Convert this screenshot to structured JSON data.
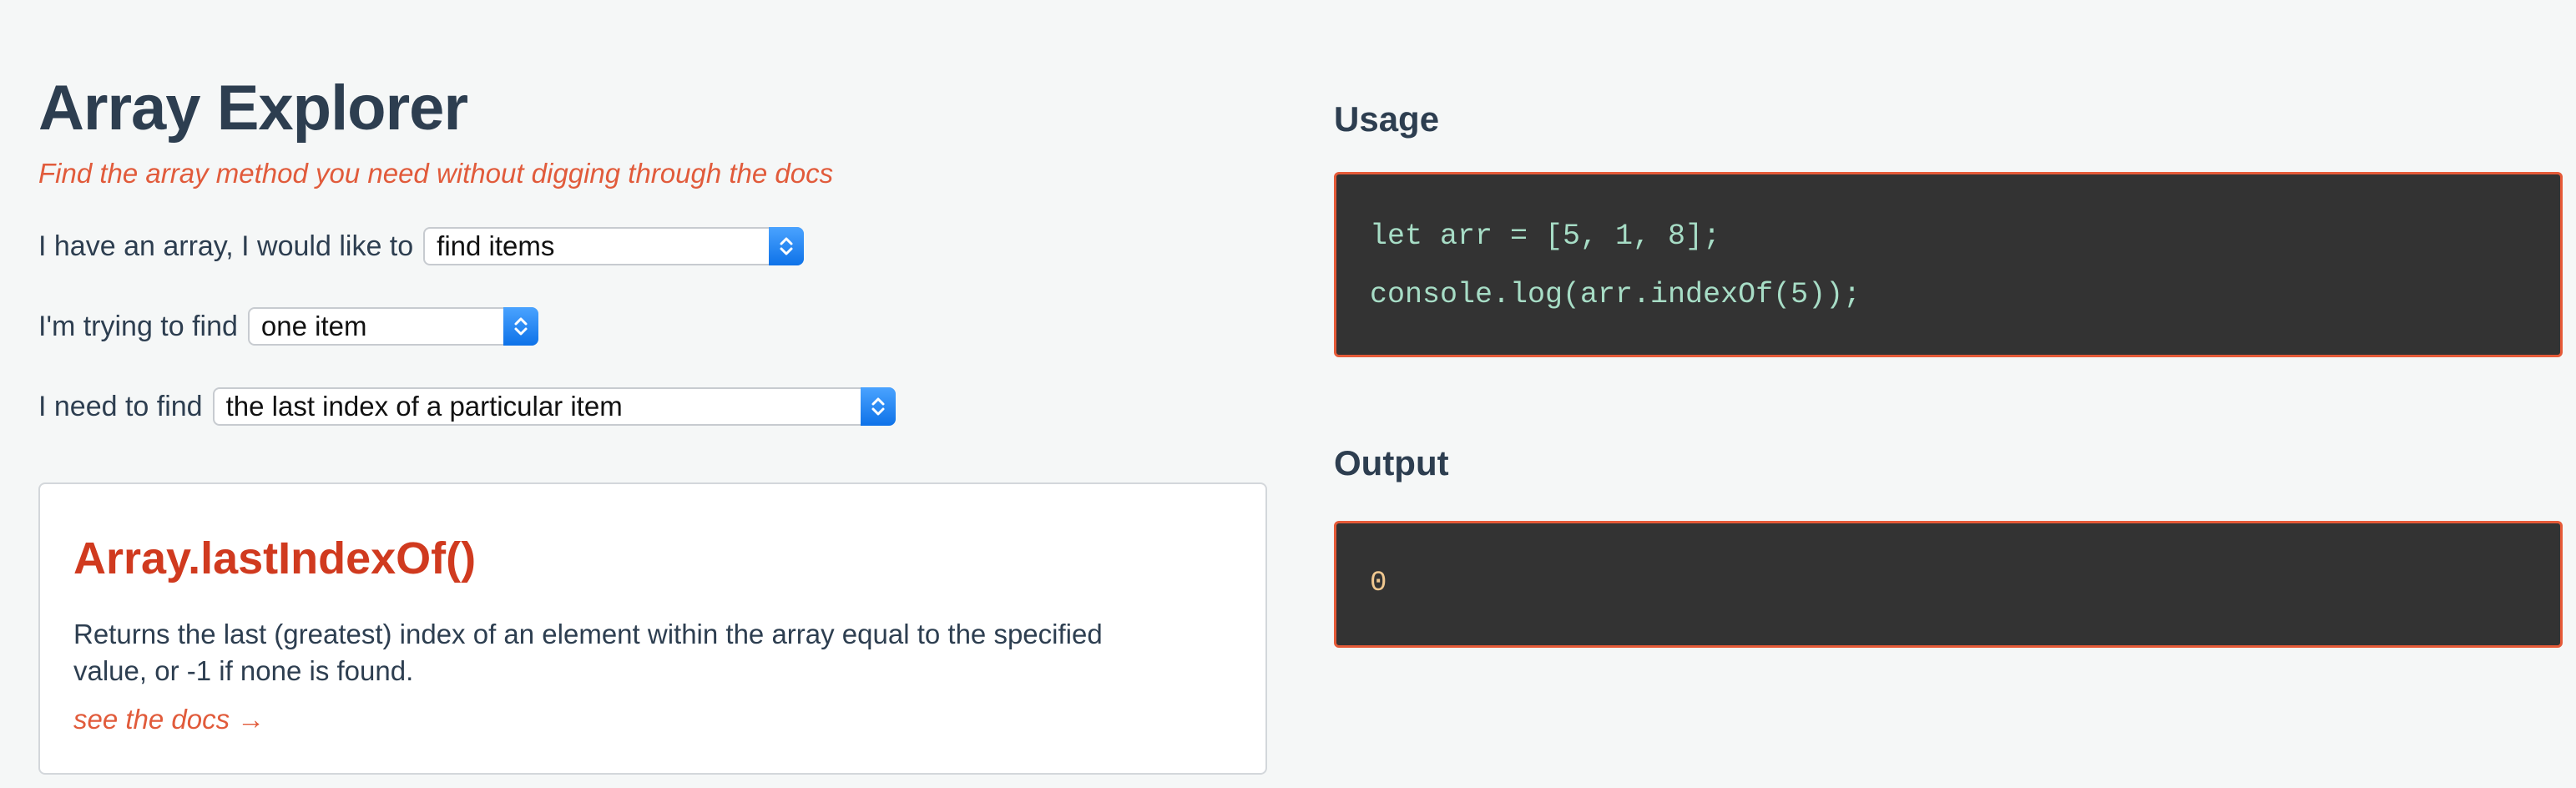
{
  "header": {
    "title": "Array Explorer",
    "subtitle": "Find the array method you need without digging through the docs"
  },
  "filters": [
    {
      "prompt": "I have an array, I would like to",
      "selected": "find items",
      "icon": "select-chevron-icon"
    },
    {
      "prompt": "I'm trying to find",
      "selected": "one item",
      "icon": "select-chevron-icon"
    },
    {
      "prompt": "I need to find",
      "selected": "the last index of a particular item",
      "icon": "select-chevron-icon"
    }
  ],
  "result": {
    "method": "Array.lastIndexOf()",
    "description": "Returns the last (greatest) index of an element within the array equal to the specified value, or -1 if none is found.",
    "docs_link": "see the docs →"
  },
  "usage": {
    "title": "Usage",
    "lines": [
      "let arr = [5, 1, 8];",
      "console.log(arr.indexOf(5));"
    ]
  },
  "output": {
    "title": "Output",
    "value": "0"
  },
  "theme": {
    "background": "#f5f7f7",
    "heading": "#2d3e50",
    "accent": "#e15b3b",
    "method_accent": "#d03a1f",
    "code_background": "#333333",
    "code_border": "#e55a38",
    "code_text": "#a7ddc6",
    "output_text": "#f0c890"
  }
}
